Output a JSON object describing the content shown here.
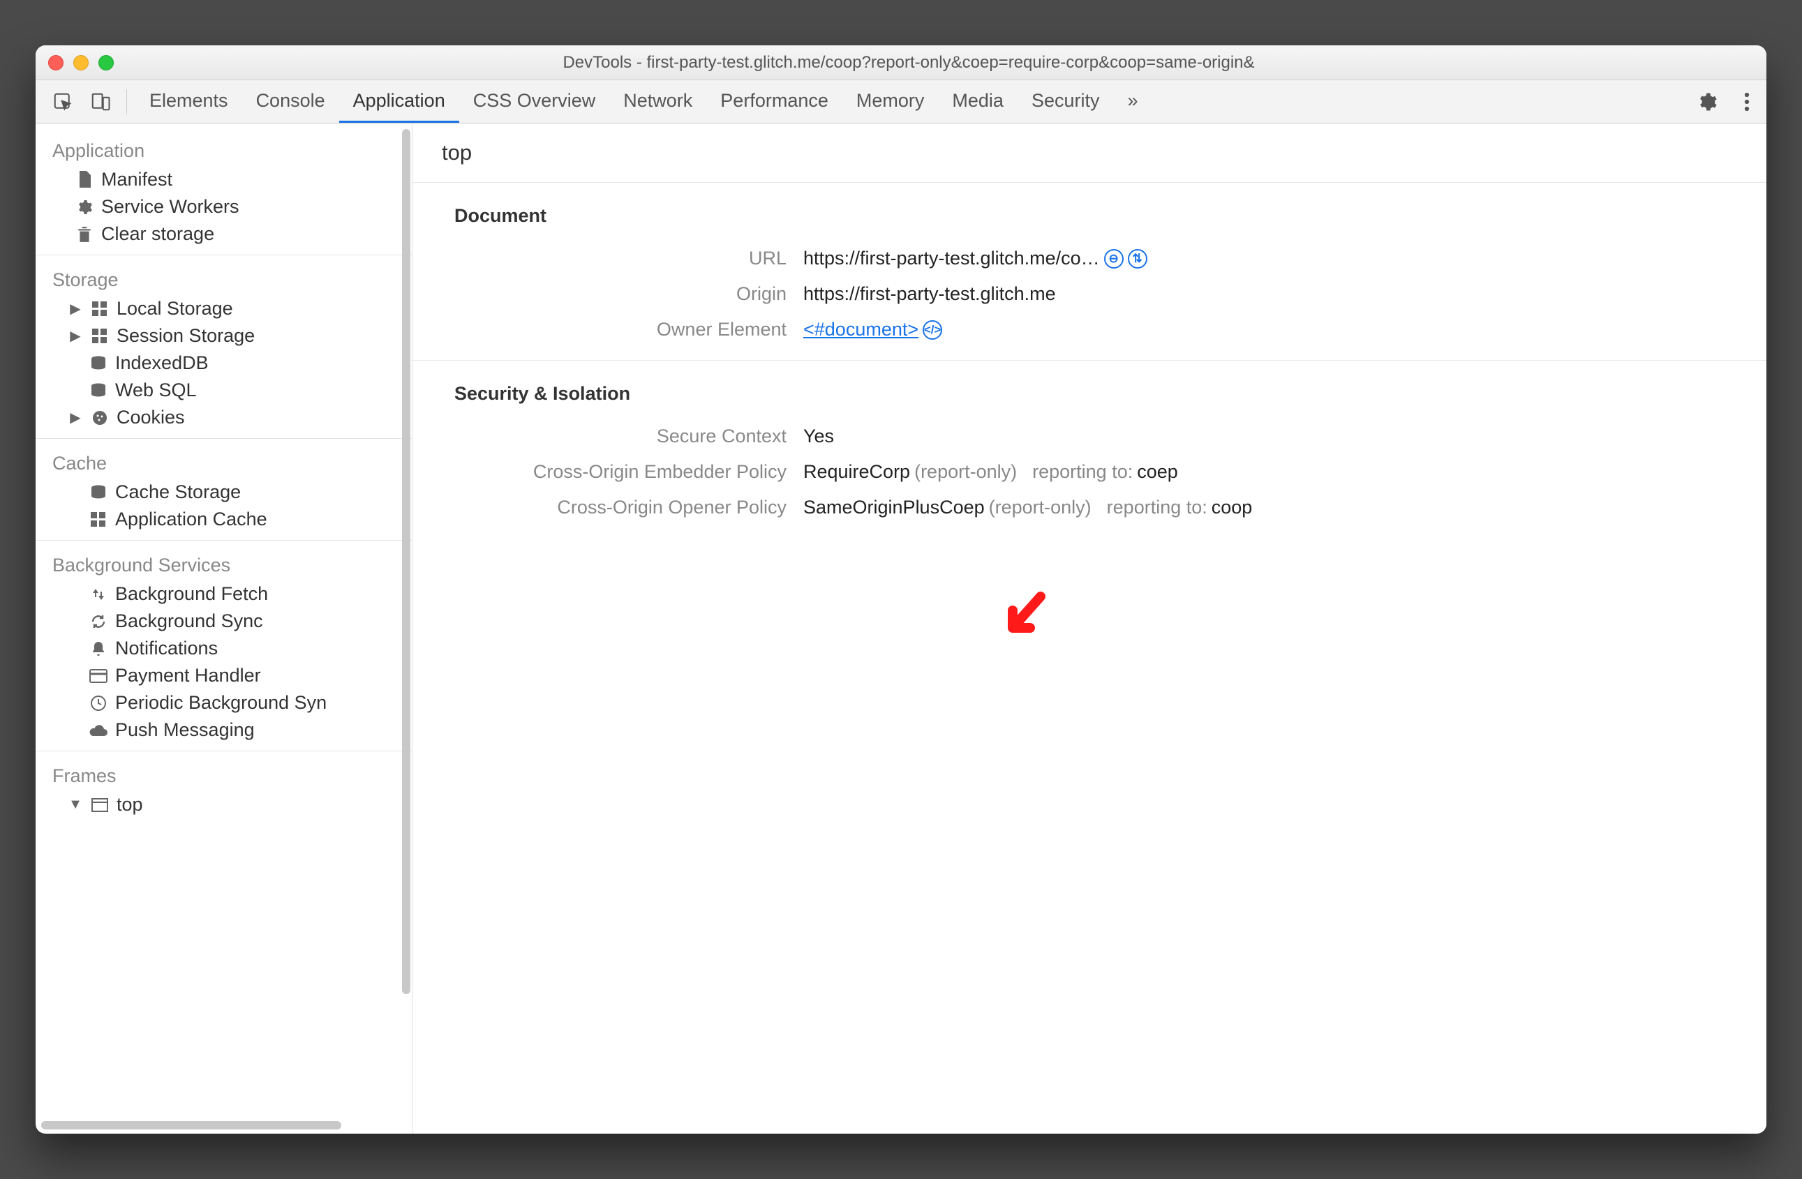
{
  "window": {
    "title": "DevTools - first-party-test.glitch.me/coop?report-only&coep=require-corp&coop=same-origin&"
  },
  "toolbar": {
    "tabs": [
      "Elements",
      "Console",
      "Application",
      "CSS Overview",
      "Network",
      "Performance",
      "Memory",
      "Media",
      "Security"
    ],
    "active": "Application",
    "overflow": "»"
  },
  "sidebar": {
    "sections": [
      {
        "title": "Application",
        "items": [
          {
            "icon": "file-icon",
            "label": "Manifest"
          },
          {
            "icon": "gear-icon",
            "label": "Service Workers"
          },
          {
            "icon": "trash-icon",
            "label": "Clear storage"
          }
        ]
      },
      {
        "title": "Storage",
        "items": [
          {
            "tree": "▶",
            "icon": "grid-icon",
            "label": "Local Storage"
          },
          {
            "tree": "▶",
            "icon": "grid-icon",
            "label": "Session Storage"
          },
          {
            "icon": "db-icon",
            "label": "IndexedDB"
          },
          {
            "icon": "db-icon",
            "label": "Web SQL"
          },
          {
            "tree": "▶",
            "icon": "cookie-icon",
            "label": "Cookies"
          }
        ]
      },
      {
        "title": "Cache",
        "items": [
          {
            "icon": "db-icon",
            "label": "Cache Storage"
          },
          {
            "icon": "grid-icon",
            "label": "Application Cache"
          }
        ]
      },
      {
        "title": "Background Services",
        "items": [
          {
            "icon": "updown-icon",
            "label": "Background Fetch"
          },
          {
            "icon": "sync-icon",
            "label": "Background Sync"
          },
          {
            "icon": "bell-icon",
            "label": "Notifications"
          },
          {
            "icon": "card-icon",
            "label": "Payment Handler"
          },
          {
            "icon": "clock-icon",
            "label": "Periodic Background Syn"
          },
          {
            "icon": "cloud-icon",
            "label": "Push Messaging"
          }
        ]
      },
      {
        "title": "Frames",
        "items": [
          {
            "tree": "▼",
            "icon": "window-icon",
            "label": "top"
          }
        ]
      }
    ]
  },
  "main": {
    "page_title": "top",
    "document": {
      "heading": "Document",
      "url_label": "URL",
      "url_value": "https://first-party-test.glitch.me/co…",
      "origin_label": "Origin",
      "origin_value": "https://first-party-test.glitch.me",
      "owner_label": "Owner Element",
      "owner_link": "<#document>"
    },
    "security": {
      "heading": "Security & Isolation",
      "secure_label": "Secure Context",
      "secure_value": "Yes",
      "coep_label": "Cross-Origin Embedder Policy",
      "coep_value": "RequireCorp",
      "coep_mode": "(report-only)",
      "coep_report_label": "reporting to:",
      "coep_report_value": "coep",
      "coop_label": "Cross-Origin Opener Policy",
      "coop_value": "SameOriginPlusCoep",
      "coop_mode": "(report-only)",
      "coop_report_label": "reporting to:",
      "coop_report_value": "coop"
    }
  }
}
